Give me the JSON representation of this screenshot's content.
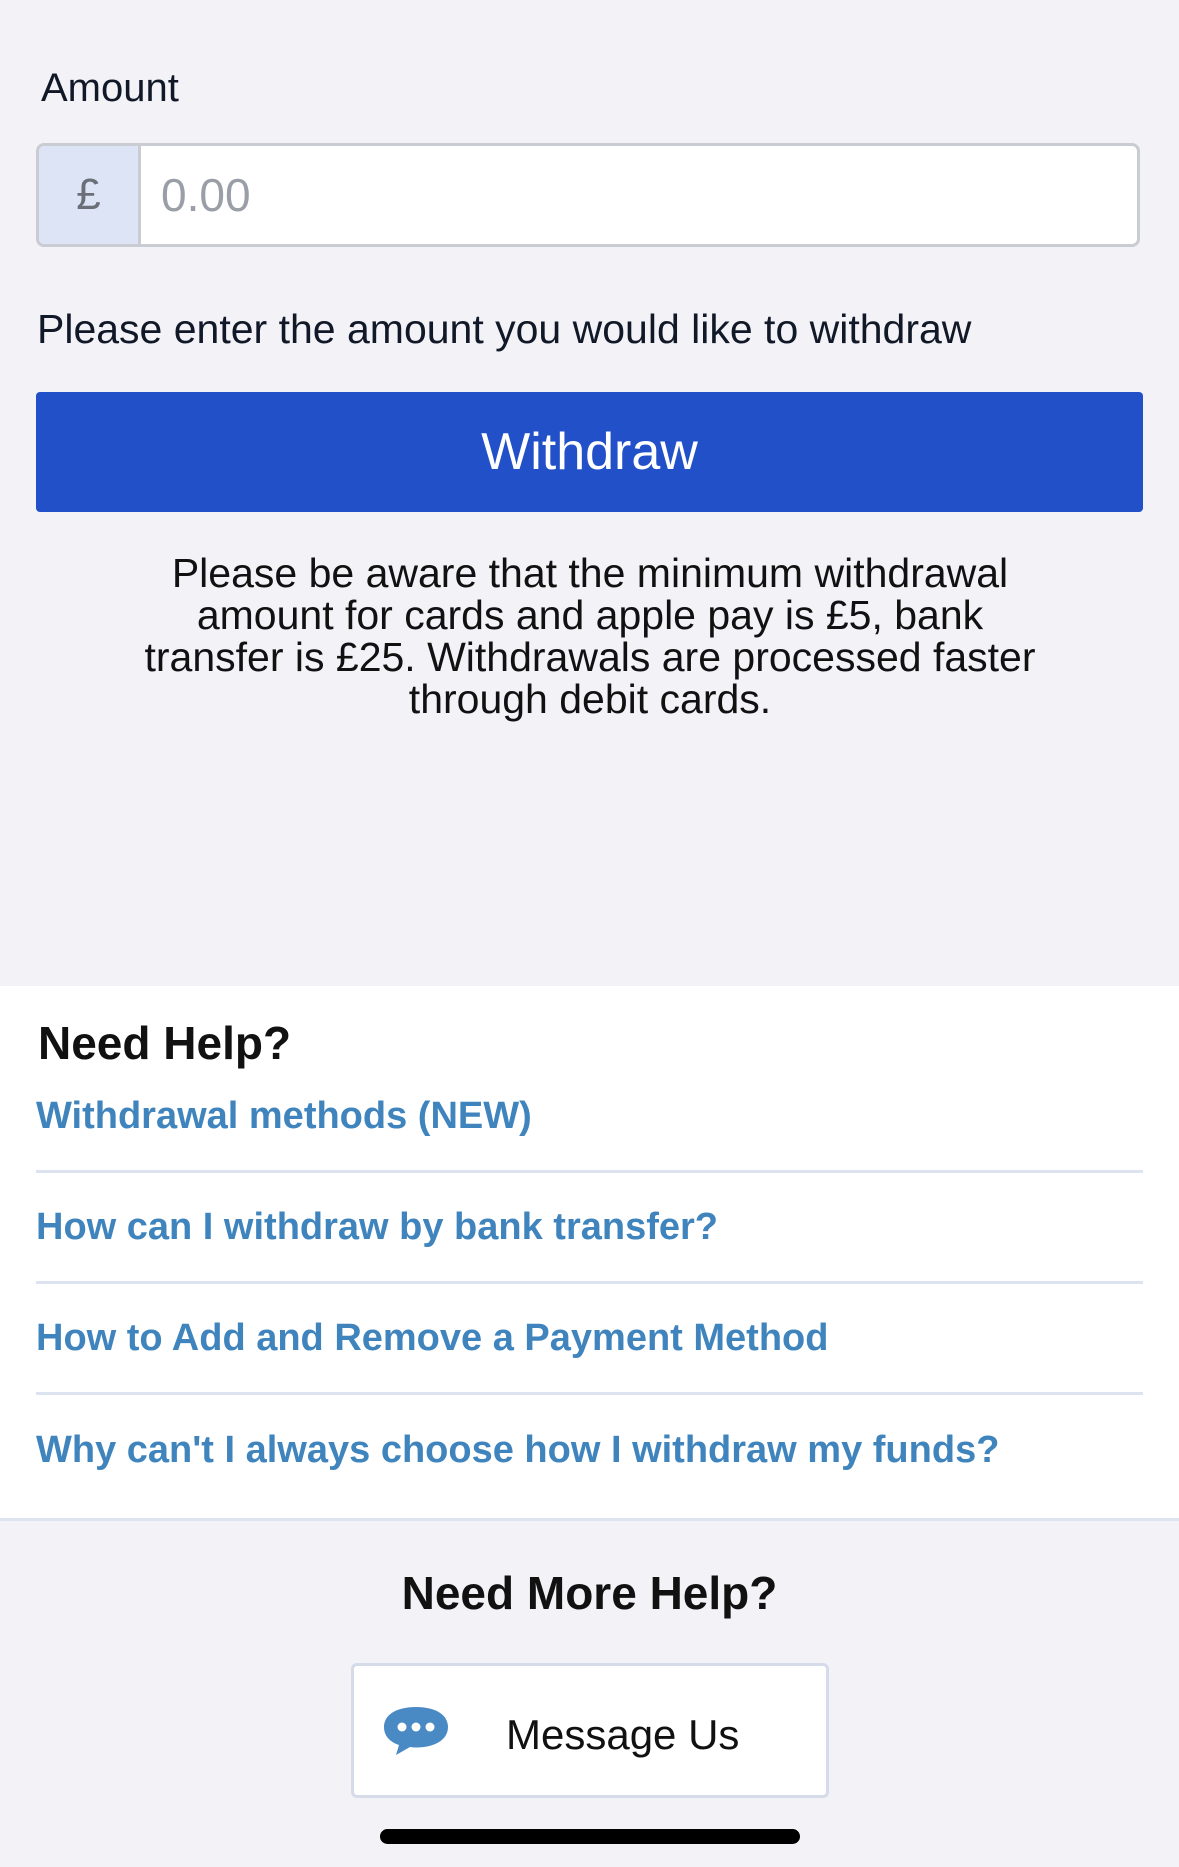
{
  "amount": {
    "label": "Amount",
    "currency_symbol": "£",
    "value": "",
    "placeholder": "0.00"
  },
  "hint": "Please enter the amount you would like to withdraw",
  "withdraw_button_label": "Withdraw",
  "notice": "Please be aware that the minimum withdrawal amount for cards and apple pay is £5, bank transfer is £25. Withdrawals are processed faster through debit cards.",
  "help": {
    "title": "Need Help?",
    "links": [
      {
        "label": "Withdrawal methods (NEW)"
      },
      {
        "label": "How can I withdraw by bank transfer?"
      },
      {
        "label": "How to Add and Remove a Payment Method"
      },
      {
        "label": "Why can't I always choose how I withdraw my funds?"
      }
    ]
  },
  "more_help": {
    "title": "Need More Help?",
    "message_button_label": "Message Us",
    "icon": "chat-bubble-icon"
  },
  "colors": {
    "primary": "#2150c8",
    "link": "#3f84bd",
    "background": "#f2f2f7",
    "chat_icon": "#4a8ac4"
  }
}
